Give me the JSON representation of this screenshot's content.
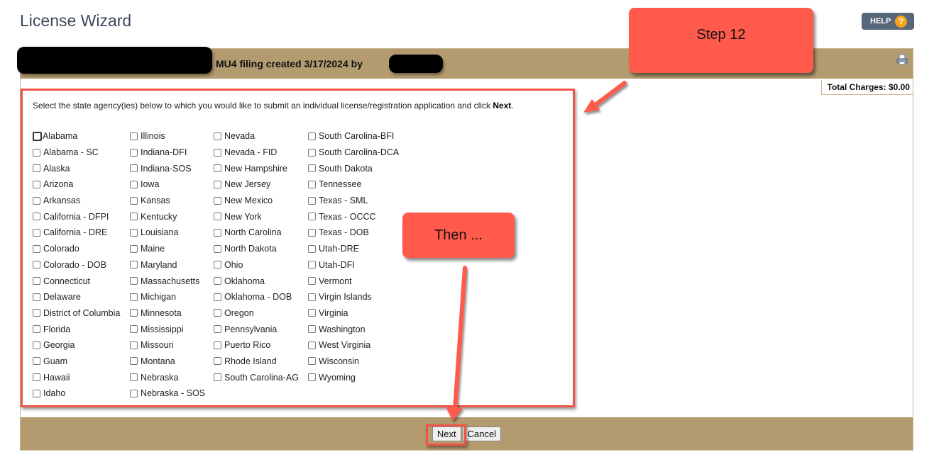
{
  "page": {
    "title": "License Wizard"
  },
  "help": {
    "label": "HELP",
    "icon": "?"
  },
  "header_bar": {
    "filing_text": "MU4 filing created 3/17/2024 by",
    "print_icon": "print-icon"
  },
  "total_charges": "Total Charges: $0.00",
  "instructions": {
    "prefix": "Select the state agency(ies) below to which you would like to submit an individual license/registration application and click ",
    "bold": "Next",
    "suffix": "."
  },
  "states": {
    "columns": [
      [
        "Alabama",
        "Alabama - SC",
        "Alaska",
        "Arizona",
        "Arkansas",
        "California - DFPI",
        "California - DRE",
        "Colorado",
        "Colorado - DOB",
        "Connecticut",
        "Delaware",
        "District of Columbia",
        "Florida",
        "Georgia",
        "Guam",
        "Hawaii",
        "Idaho"
      ],
      [
        "Illinois",
        "Indiana-DFI",
        "Indiana-SOS",
        "Iowa",
        "Kansas",
        "Kentucky",
        "Louisiana",
        "Maine",
        "Maryland",
        "Massachusetts",
        "Michigan",
        "Minnesota",
        "Mississippi",
        "Missouri",
        "Montana",
        "Nebraska",
        "Nebraska - SOS"
      ],
      [
        "Nevada",
        "Nevada - FID",
        "New Hampshire",
        "New Jersey",
        "New Mexico",
        "New York",
        "North Carolina",
        "North Dakota",
        "Ohio",
        "Oklahoma",
        "Oklahoma - DOB",
        "Oregon",
        "Pennsylvania",
        "Puerto Rico",
        "Rhode Island",
        "South Carolina-AG"
      ],
      [
        "South Carolina-BFI",
        "South Carolina-DCA",
        "South Dakota",
        "Tennessee",
        "Texas - SML",
        "Texas - OCCC",
        "Texas - DOB",
        "Utah-DRE",
        "Utah-DFI",
        "Vermont",
        "Virgin Islands",
        "Virginia",
        "Washington",
        "West Virginia",
        "Wisconsin",
        "Wyoming"
      ]
    ],
    "checked": []
  },
  "buttons": {
    "next": "Next",
    "cancel": "Cancel"
  },
  "annotations": {
    "step_label": "Step 12",
    "then_label": "Then ...",
    "color": "#ff5a4b"
  }
}
